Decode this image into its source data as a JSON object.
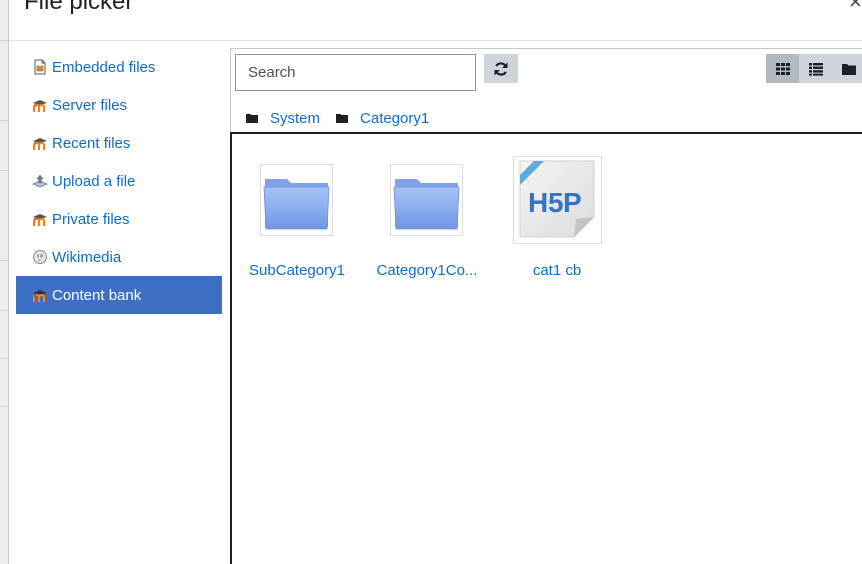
{
  "dialog": {
    "title": "File picker",
    "close_symbol": "×"
  },
  "sidebar": {
    "items": [
      {
        "label": "Embedded files",
        "icon": "embedded-file-icon",
        "active": false
      },
      {
        "label": "Server files",
        "icon": "moodle-icon",
        "active": false
      },
      {
        "label": "Recent files",
        "icon": "moodle-icon",
        "active": false
      },
      {
        "label": "Upload a file",
        "icon": "upload-icon",
        "active": false
      },
      {
        "label": "Private files",
        "icon": "moodle-icon",
        "active": false
      },
      {
        "label": "Wikimedia",
        "icon": "wikimedia-globe-icon",
        "active": false
      },
      {
        "label": "Content bank",
        "icon": "moodle-icon",
        "active": true
      }
    ]
  },
  "toolbar": {
    "search_placeholder": "Search",
    "refresh_icon": "refresh-icon",
    "view_modes": [
      "grid-view-icon",
      "list-view-icon",
      "tree-view-icon"
    ],
    "selected_view": "grid-view-icon"
  },
  "breadcrumb": [
    {
      "label": "System",
      "icon": "folder-icon"
    },
    {
      "label": "Category1",
      "icon": "folder-icon"
    }
  ],
  "files": [
    {
      "label": "SubCategory1",
      "type": "folder",
      "icon": "folder-icon"
    },
    {
      "label": "Category1Co...",
      "type": "folder",
      "icon": "folder-icon"
    },
    {
      "label": "cat1 cb",
      "type": "h5p",
      "icon": "h5p-icon"
    }
  ],
  "colors": {
    "link": "#0f6cbf",
    "active_bg": "#3f6fc4",
    "button_bg": "#ced4da"
  }
}
